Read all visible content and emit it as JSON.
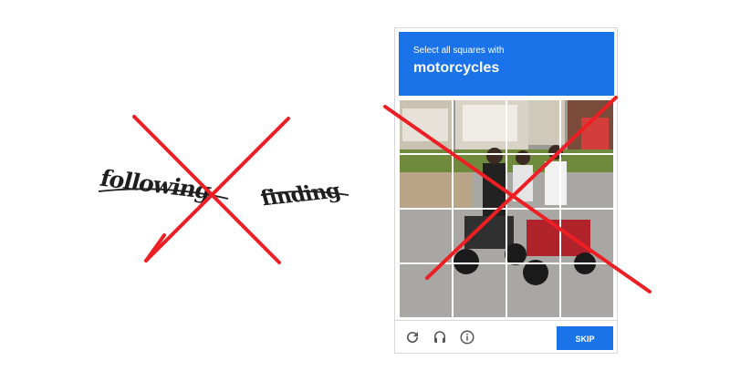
{
  "text_captcha": {
    "words": [
      "following",
      "finding"
    ]
  },
  "image_captcha": {
    "prompt": "Select all squares with",
    "target": "motorcycles",
    "grid": {
      "rows": 4,
      "cols": 4
    },
    "footer": {
      "icons": [
        "reload-icon",
        "audio-icon",
        "info-icon"
      ],
      "skip_label": "SKIP"
    },
    "accent_color": "#1a73e8"
  },
  "overlay": {
    "cross_color": "#ee1f24"
  }
}
